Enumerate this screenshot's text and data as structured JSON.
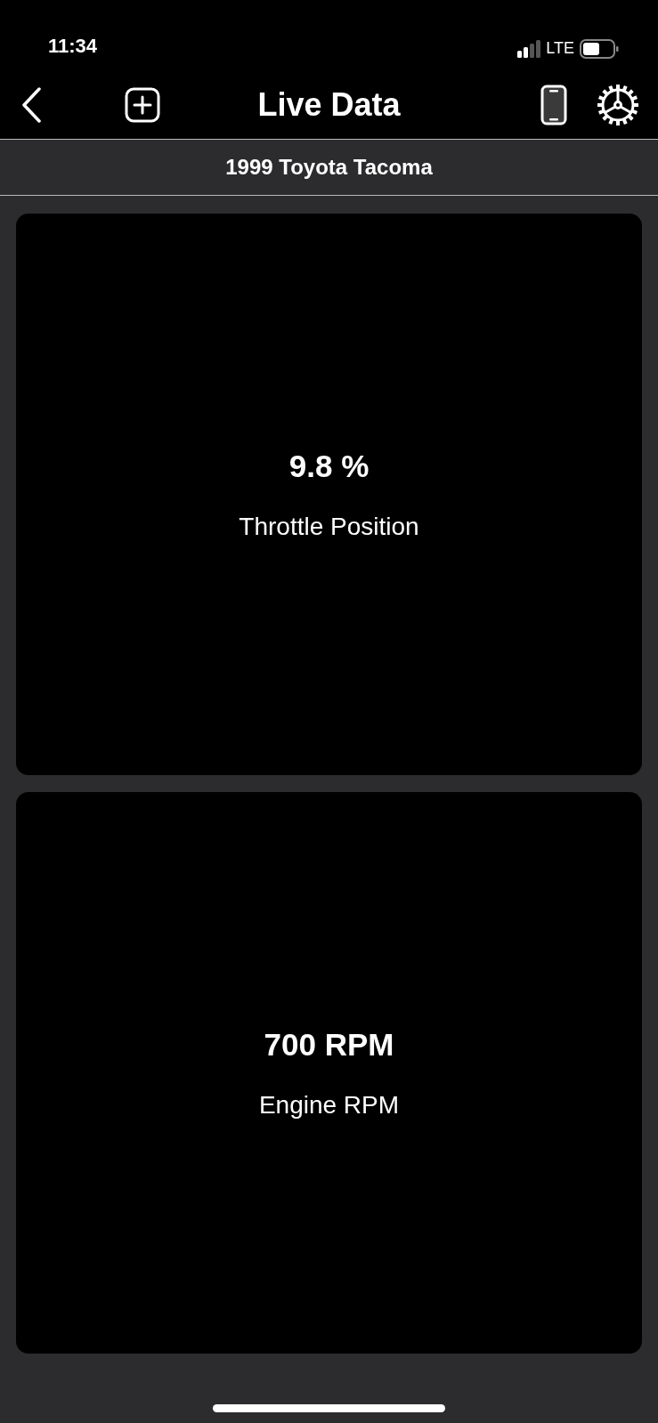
{
  "status_bar": {
    "time": "11:34",
    "network": "LTE"
  },
  "nav": {
    "title": "Live Data"
  },
  "vehicle": "1999 Toyota Tacoma",
  "gauges": [
    {
      "value": "9.8 %",
      "label": "Throttle Position"
    },
    {
      "value": "700 RPM",
      "label": "Engine RPM"
    }
  ]
}
